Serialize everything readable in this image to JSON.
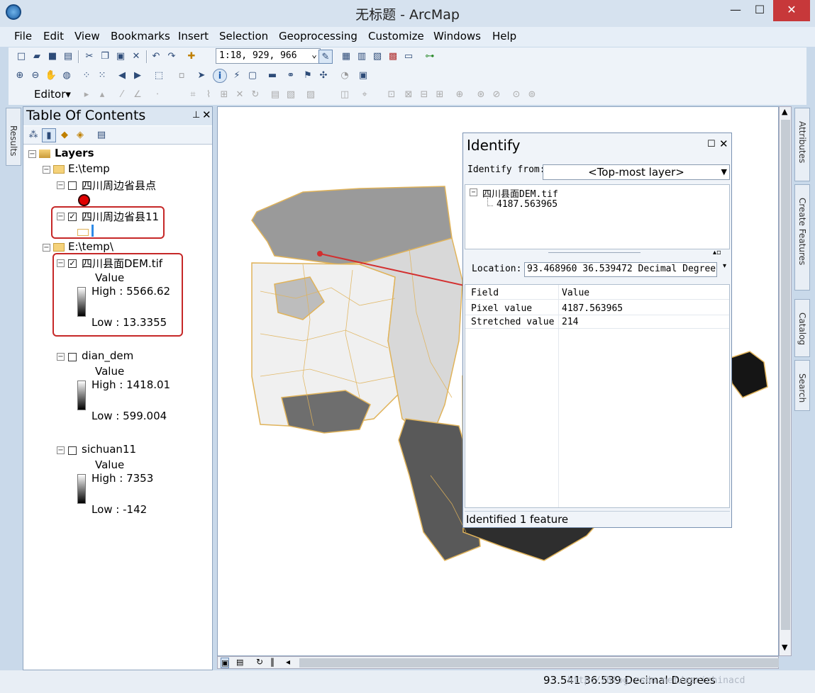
{
  "window": {
    "title": "无标题 - ArcMap",
    "minimize": "—",
    "maximize": "☐",
    "close": "✕"
  },
  "menu": [
    "File",
    "Edit",
    "View",
    "Bookmarks",
    "Insert",
    "Selection",
    "Geoprocessing",
    "Customize",
    "Windows",
    "Help"
  ],
  "toolbar": {
    "scale": "1:18, 929, 966",
    "editor_label": "Editor"
  },
  "dock_tabs": {
    "results": "Results",
    "attributes": "Attributes",
    "create_features": "Create Features",
    "catalog": "Catalog",
    "search": "Search"
  },
  "toc": {
    "title": "Table Of Contents",
    "root": "Layers",
    "group1": "E:\\temp",
    "layer_points": "四川周边省县点",
    "layer_polys": "四川周边省县11",
    "group2": "E:\\temp\\",
    "layer_dem": "四川县面DEM.tif",
    "dem_value": "Value",
    "dem_high": "High : 5566.62",
    "dem_low": "Low : 13.3355",
    "layer_dian": "dian_dem",
    "dian_value": "Value",
    "dian_high": "High : 1418.01",
    "dian_low": "Low : 599.004",
    "layer_sichuan": "sichuan11",
    "sichuan_value": "Value",
    "sichuan_high": "High : 7353",
    "sichuan_low": "Low : -142"
  },
  "identify": {
    "title": "Identify",
    "identify_from_label": "Identify from:",
    "layer_option": "<Top-most layer>",
    "tree_layer": "四川县面DEM.tif",
    "tree_value": "4187.563965",
    "location_label": "Location:",
    "location_value": "93.468960  36.539472 Decimal Degrees",
    "grid_header": [
      "Field",
      "Value"
    ],
    "rows": [
      {
        "field": "Pixel value",
        "value": "4187.563965"
      },
      {
        "field": "Stretched value",
        "value": "214"
      }
    ],
    "status": "Identified 1 feature"
  },
  "statusbar": {
    "coords": "93.541  36.539 Decimal Degrees",
    "watermark": "http://blog.csdn.net/esrichinacd"
  },
  "colors": {
    "callout": "#c62828",
    "boundary": "#e0b35a",
    "close_button": "#c7383a"
  }
}
